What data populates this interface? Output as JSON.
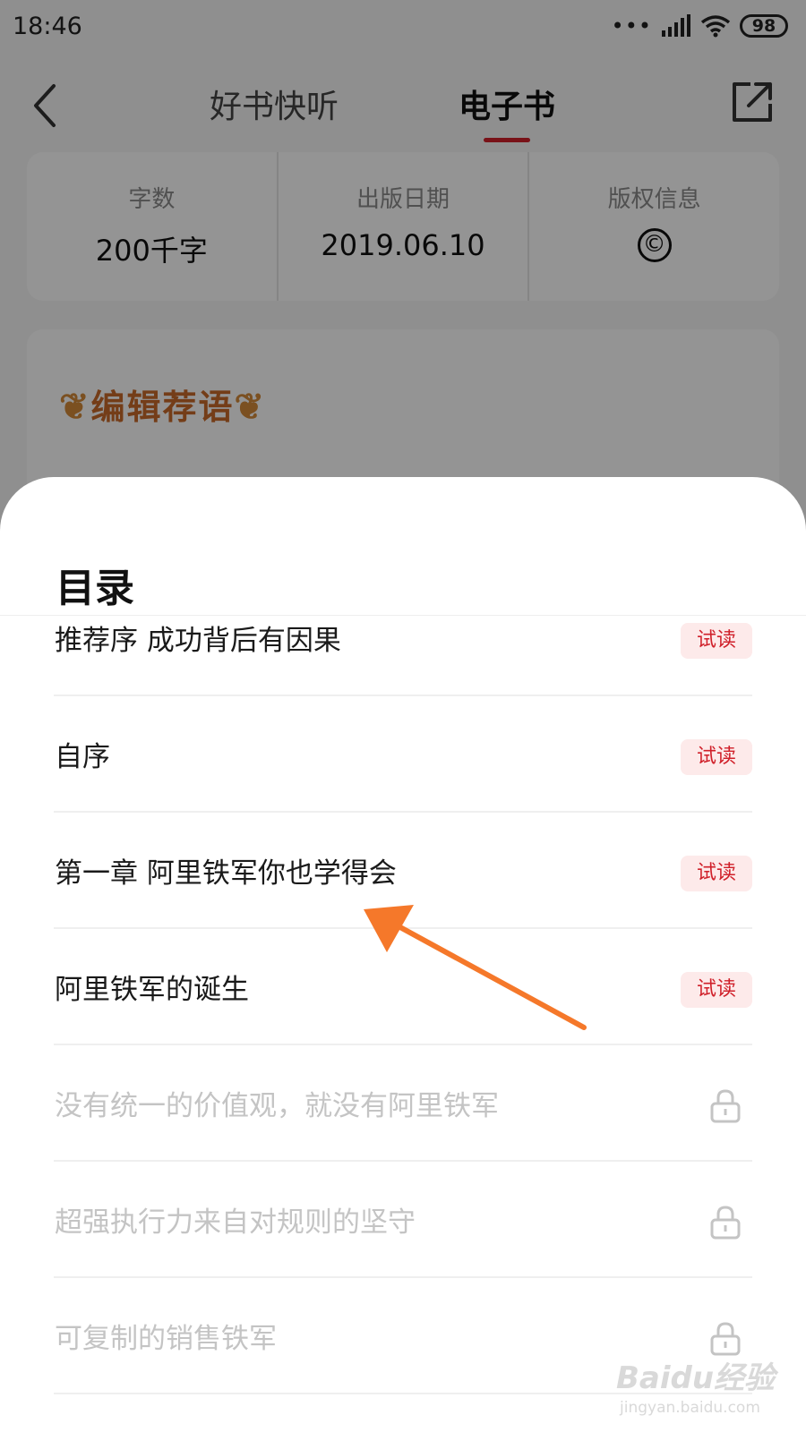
{
  "status_bar": {
    "time": "18:46",
    "signal_dots": "•••",
    "battery": "98"
  },
  "nav": {
    "tabs": [
      {
        "label": "好书快听"
      },
      {
        "label": "电子书"
      }
    ]
  },
  "info": [
    {
      "label": "字数",
      "value": "200千字"
    },
    {
      "label": "出版日期",
      "value": "2019.06.10"
    },
    {
      "label": "版权信息",
      "icon": "copyright-icon",
      "glyph": "©"
    }
  ],
  "editor_card": {
    "title": "编辑荐语"
  },
  "toc": {
    "title": "目录",
    "items": [
      {
        "text": "推荐序 成功背后有因果",
        "badge": "试读",
        "locked": false
      },
      {
        "text": "自序",
        "badge": "试读",
        "locked": false
      },
      {
        "text": "第一章 阿里铁军你也学得会",
        "badge": "试读",
        "locked": false
      },
      {
        "text": "阿里铁军的诞生",
        "badge": "试读",
        "locked": false
      },
      {
        "text": "没有统一的价值观，就没有阿里铁军",
        "icon": "lock-icon",
        "locked": true
      },
      {
        "text": "超强执行力来自对规则的坚守",
        "icon": "lock-icon",
        "locked": true
      },
      {
        "text": "可复制的销售铁军",
        "icon": "lock-icon",
        "locked": true
      }
    ]
  },
  "colors": {
    "accent": "#d0202a",
    "badge_bg": "#fdeaea",
    "annotation_arrow": "#f5782a",
    "editor_title": "#c86a2a"
  },
  "watermark": {
    "brand": "Baidu经验",
    "url": "jingyan.baidu.com"
  }
}
